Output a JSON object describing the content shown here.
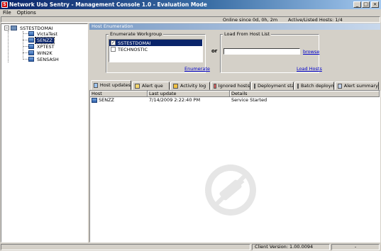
{
  "window": {
    "title": "Network Usb Sentry - Management Console 1.0 - Evaluation Mode",
    "app_icon": "S",
    "colors": {
      "titlebar_start": "#0a246a",
      "selection": "#0a246a",
      "link": "#0000cc",
      "section_header": "#7b9cc6"
    }
  },
  "menu": {
    "items": [
      {
        "label": "File"
      },
      {
        "label": "Options"
      }
    ]
  },
  "status_top": {
    "online": "Online since 0d, 0h, 2m",
    "hosts": "Active/Listed Hosts: 1/4"
  },
  "tree": {
    "root": {
      "label": "SSTESTDOMAI",
      "expander": "−",
      "icon": "domain-icon"
    },
    "hosts": [
      {
        "label": "VictaTest",
        "selected": false,
        "icon": "computer-icon"
      },
      {
        "label": "SENZZ",
        "selected": true,
        "icon": "computer-icon"
      },
      {
        "label": "XPTEST",
        "selected": false,
        "icon": "computer-icon"
      },
      {
        "label": "WIN2K",
        "selected": false,
        "icon": "computer-icon"
      },
      {
        "label": "SENSASH",
        "selected": false,
        "icon": "computer-icon"
      }
    ]
  },
  "host_enumeration": {
    "title": "Host Enumeration",
    "workgroup": {
      "legend": "Enumerate Workgroup",
      "items": [
        {
          "label": "SSTESTDOMAI",
          "checked": true,
          "selected": true
        },
        {
          "label": "TECHNOSTIC",
          "checked": false,
          "selected": false
        }
      ],
      "enumerate_link": "Enumerate"
    },
    "or_label": "or",
    "host_list": {
      "legend": "Load From Host List",
      "input_value": "",
      "browse_link": "browse",
      "load_link": "Load Hosts"
    }
  },
  "tabs": [
    {
      "label": "Host updates",
      "active": true,
      "icon": "refresh-icon"
    },
    {
      "label": "Alert que",
      "active": false,
      "icon": "alert-icon"
    },
    {
      "label": "Activity log",
      "active": false,
      "icon": "log-icon"
    },
    {
      "label": "Ignored hosts",
      "active": false,
      "icon": "ignore-icon"
    },
    {
      "label": "Deployment status",
      "active": false,
      "icon": "deploy-icon"
    },
    {
      "label": "Batch deployment",
      "active": false,
      "icon": "batch-icon"
    },
    {
      "label": "Alert summary",
      "active": false,
      "icon": "summary-icon"
    }
  ],
  "grid": {
    "columns": [
      "Host",
      "Last update",
      "Details"
    ],
    "rows": [
      {
        "host": "SENZZ",
        "last_update": "7/14/2009 2:22:40 PM",
        "details": "Service Started"
      }
    ]
  },
  "status_bottom": {
    "client_version": "Client Version: 1.00.0094",
    "extra": "-"
  }
}
